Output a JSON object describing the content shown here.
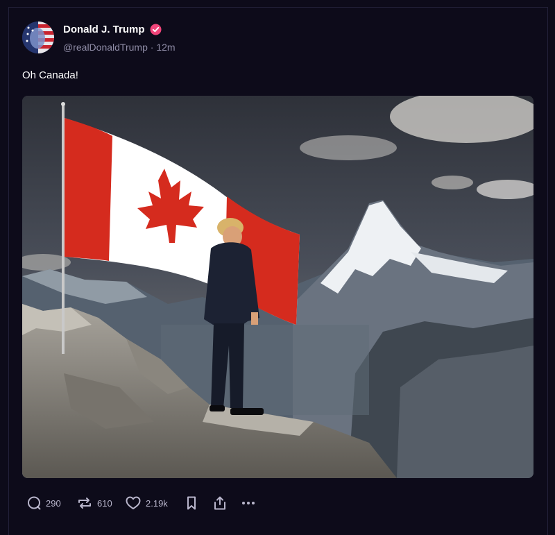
{
  "post": {
    "author_name": "Donald J. Trump",
    "handle": "@realDonaldTrump",
    "separator": "·",
    "time": "12m",
    "text": "Oh Canada!",
    "verified_badge_color": "#f0457a"
  },
  "actions": {
    "replies": "290",
    "reposts": "610",
    "likes": "2.19k"
  },
  "icons": [
    "reply-icon",
    "repost-icon",
    "like-icon",
    "bookmark-icon",
    "share-icon",
    "more-icon",
    "verified-icon"
  ],
  "colors": {
    "background": "#0d0b1a",
    "text_primary": "#ffffff",
    "text_secondary": "#8f8ca6",
    "flag_red": "#d52b1e"
  }
}
